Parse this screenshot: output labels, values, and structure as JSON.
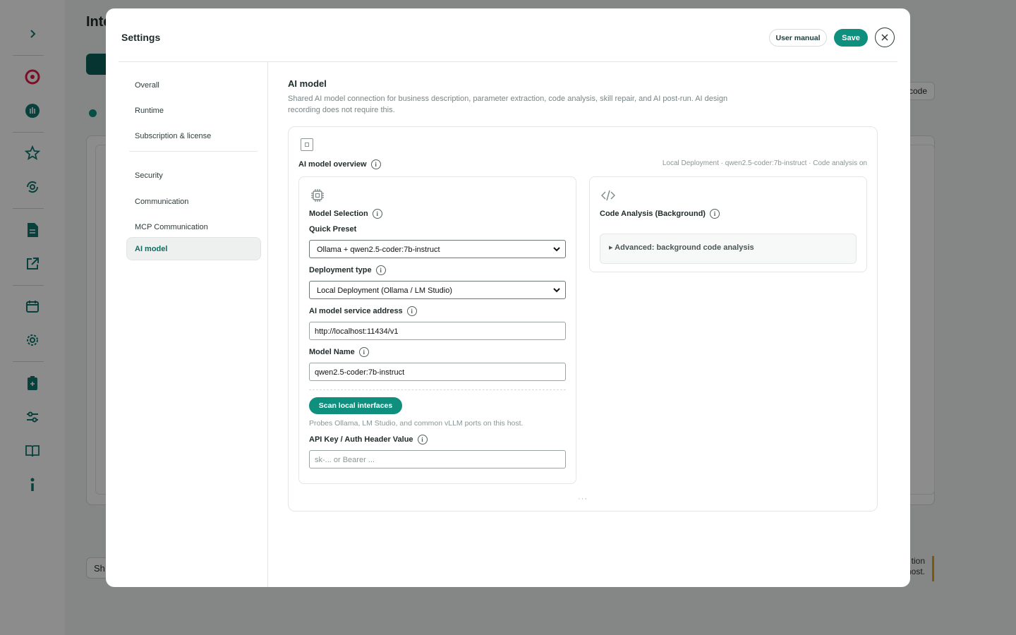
{
  "background": {
    "page_title": "Inte",
    "code_button": "code",
    "show_button": "Sh",
    "note_lines": [
      "tion",
      "host."
    ],
    "sidebar_icons": [
      "chevron-right-icon",
      "target-icon",
      "hand-icon",
      "star-badge-icon",
      "refresh-gear-icon",
      "document-icon",
      "external-link-icon",
      "calendar-icon",
      "settings-icon",
      "clipboard-icon",
      "sliders-icon",
      "book-icon",
      "info-icon"
    ]
  },
  "modal": {
    "title": "Settings",
    "user_manual_label": "User manual",
    "save_label": "Save"
  },
  "nav": {
    "items": [
      {
        "label": "Overall"
      },
      {
        "label": "Runtime"
      },
      {
        "label": "Subscription & license"
      },
      {
        "label": "Security"
      },
      {
        "label": "Communication"
      },
      {
        "label": "MCP Communication"
      },
      {
        "label": "AI model",
        "active": true
      }
    ]
  },
  "section": {
    "title": "AI model",
    "description": "Shared AI model connection for business description, parameter extraction, code analysis, skill repair, and AI post-run. AI design recording does not require this."
  },
  "overview": {
    "title": "AI model overview",
    "status": "Local Deployment · qwen2.5-coder:7b-instruct · Code analysis on"
  },
  "model_selection": {
    "heading": "Model Selection",
    "quick_preset_label": "Quick Preset",
    "quick_preset_value": "Ollama + qwen2.5-coder:7b-instruct",
    "deployment_type_label": "Deployment type",
    "deployment_type_value": "Local Deployment (Ollama / LM Studio)",
    "service_address_label": "AI model service address",
    "service_address_value": "http://localhost:11434/v1",
    "model_name_label": "Model Name",
    "model_name_value": "qwen2.5-coder:7b-instruct",
    "scan_button_label": "Scan local interfaces",
    "scan_hint": "Probes Ollama, LM Studio, and common vLLM ports on this host.",
    "api_key_label": "API Key / Auth Header Value",
    "api_key_placeholder": "sk-... or Bearer ..."
  },
  "code_analysis": {
    "heading": "Code Analysis (Background)",
    "advanced_toggle": "▸ Advanced: background code analysis"
  },
  "colors": {
    "accent": "#0f8f7e",
    "overlay": "rgba(0,0,0,0.45)",
    "active_nav_text": "#0f6b60"
  }
}
